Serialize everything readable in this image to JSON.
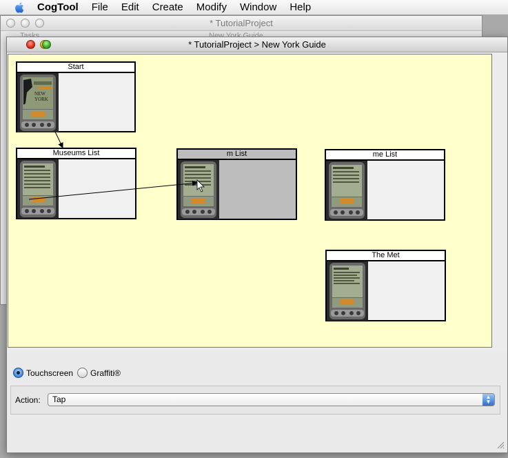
{
  "menubar": {
    "app": "CogTool",
    "items": [
      "File",
      "Edit",
      "Create",
      "Modify",
      "Window",
      "Help"
    ]
  },
  "background_window": {
    "title": "* TutorialProject",
    "tab_left": "Tasks",
    "tab_right": "New York Guide"
  },
  "window": {
    "title": "* TutorialProject > New York Guide"
  },
  "frames": [
    {
      "label": "Start",
      "selected": false
    },
    {
      "label": "Museums List",
      "selected": false
    },
    {
      "label": "m List",
      "selected": true
    },
    {
      "label": "me List",
      "selected": false
    },
    {
      "label": "The Met",
      "selected": false
    }
  ],
  "device": {
    "options": [
      "Touchscreen",
      "Graffiti®"
    ],
    "selected": "Touchscreen"
  },
  "action": {
    "label": "Action:",
    "value": "Tap"
  },
  "colors": {
    "canvas": "#ffffcc",
    "selected_frame": "#bdbdbd",
    "frame_body": "#f0f0f0"
  }
}
